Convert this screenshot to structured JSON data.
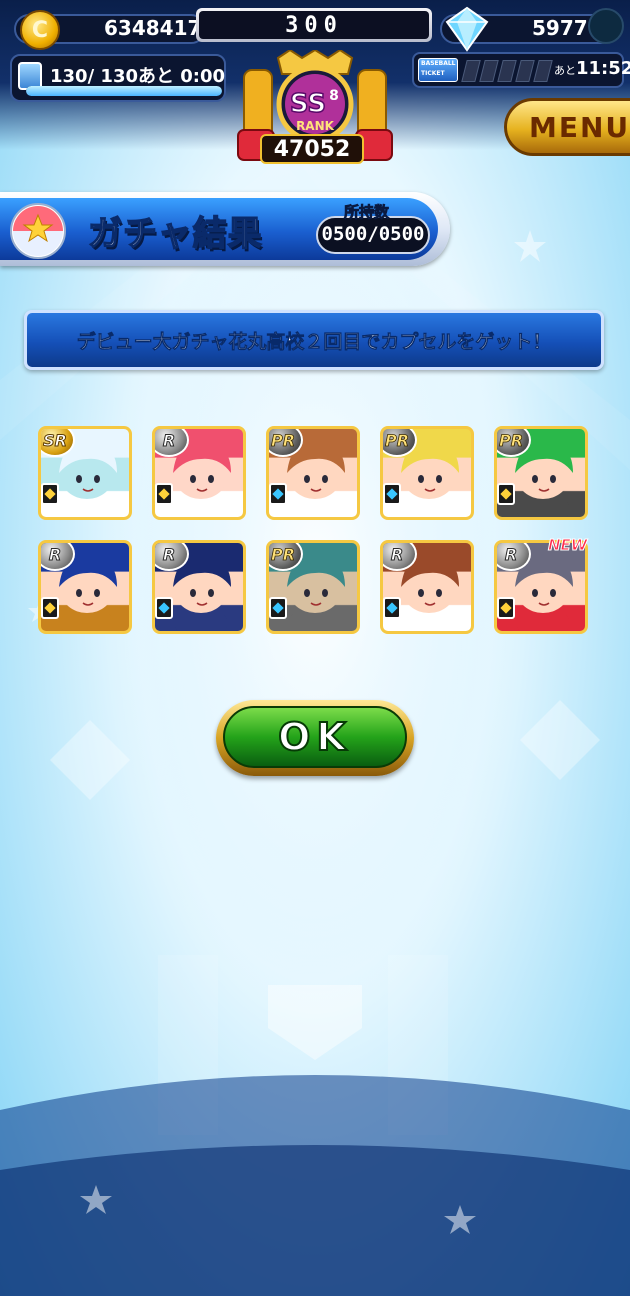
{
  "header": {
    "coins": "6348417",
    "center_value": "300",
    "gems": "5977",
    "stamina_text": "130/ 130あと  0:00",
    "stamina_level": 1.0,
    "ticket_label_1": "BASEBALL",
    "ticket_label_2": "TICKET",
    "ticket_prefix": "あと",
    "ticket_time": "11:52",
    "rank_letters": "SS",
    "rank_number": "8",
    "rank_label": "RANK",
    "rank_points": "47052",
    "menu_label": "MENU"
  },
  "title_banner": {
    "title": "ガチャ結果",
    "own_label": "所持数",
    "own_value": "0500/0500"
  },
  "message": "デビュー大ガチャ花丸高校２回目でカプセルをゲット！",
  "cards": [
    {
      "rarity": "SR",
      "type": "gold",
      "palette": [
        "#e8f6ff",
        "#b8e8ee",
        "#ffffff"
      ],
      "new": false
    },
    {
      "rarity": "R",
      "type": "gold",
      "palette": [
        "#f0506e",
        "#ffd7c8",
        "#ffffff"
      ],
      "new": false
    },
    {
      "rarity": "PR",
      "type": "blue",
      "palette": [
        "#b86a38",
        "#ffd7c0",
        "#ffffff"
      ],
      "new": false
    },
    {
      "rarity": "PR",
      "type": "blue",
      "palette": [
        "#f0d84a",
        "#ffd7c0",
        "#ffffff"
      ],
      "new": false
    },
    {
      "rarity": "PR",
      "type": "gold",
      "palette": [
        "#2ab84a",
        "#ffd7c0",
        "#4a4a4a"
      ],
      "new": false
    },
    {
      "rarity": "R",
      "type": "gold",
      "palette": [
        "#1a3aa0",
        "#ffd7c0",
        "#c8821e"
      ],
      "new": false
    },
    {
      "rarity": "R",
      "type": "blue",
      "palette": [
        "#1a2a70",
        "#ffd7c0",
        "#2a3a80"
      ],
      "new": false
    },
    {
      "rarity": "PR",
      "type": "blue",
      "palette": [
        "#3a8a8a",
        "#d8c0a0",
        "#6a6a6a"
      ],
      "new": false
    },
    {
      "rarity": "R",
      "type": "blue",
      "palette": [
        "#9a4a2a",
        "#ffd7c0",
        "#ffffff"
      ],
      "new": false
    },
    {
      "rarity": "R",
      "type": "gold",
      "palette": [
        "#6a6a80",
        "#ffd7c0",
        "#e02a3a"
      ],
      "new": true
    }
  ],
  "new_label": "NEW",
  "ok_label": "OK",
  "colors": {
    "accent_blue": "#1a5fd0",
    "gold": "#f5c842",
    "ok_green": "#24a31a"
  }
}
